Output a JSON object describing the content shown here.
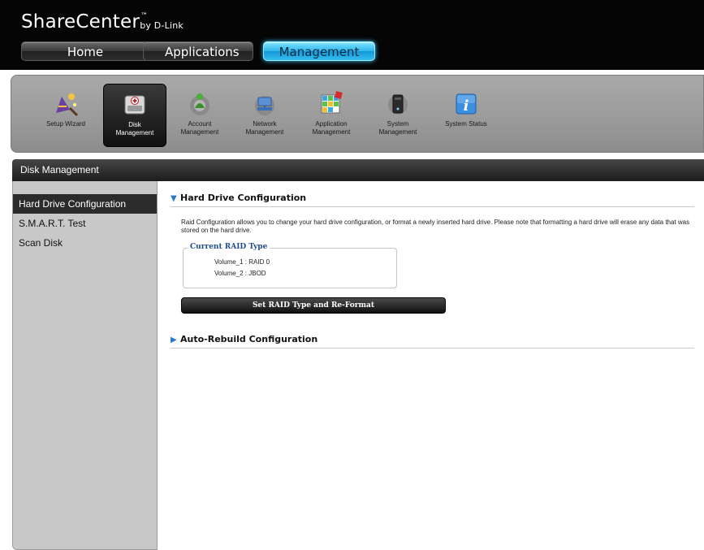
{
  "header": {
    "logo_main": "ShareCenter",
    "logo_tm": "™",
    "logo_by": "by D-Link",
    "tabs": [
      {
        "label": "Home"
      },
      {
        "label": "Applications"
      },
      {
        "label": "Management"
      }
    ]
  },
  "toolbar": {
    "items": [
      {
        "label1": "Setup Wizard",
        "label2": "",
        "icon": "wizard-icon"
      },
      {
        "label1": "Disk",
        "label2": "Management",
        "icon": "disk-icon"
      },
      {
        "label1": "Account",
        "label2": "Management",
        "icon": "account-icon"
      },
      {
        "label1": "Network",
        "label2": "Management",
        "icon": "network-icon"
      },
      {
        "label1": "Application",
        "label2": "Management",
        "icon": "application-icon"
      },
      {
        "label1": "System",
        "label2": "Management",
        "icon": "system-icon"
      },
      {
        "label1": "System Status",
        "label2": "",
        "icon": "info-icon"
      }
    ]
  },
  "section_title": "Disk Management",
  "sidebar": {
    "items": [
      {
        "label": "Hard Drive Configuration"
      },
      {
        "label": "S.M.A.R.T. Test"
      },
      {
        "label": "Scan Disk"
      }
    ]
  },
  "main": {
    "hdc_title": "Hard Drive Configuration",
    "description": "Raid Configuration allows you to change your hard drive configuration, or format a newly inserted hard drive. Please note that formatting a hard drive will erase any data that was stored on the hard drive.",
    "raid_legend": "Current RAID Type",
    "raid_lines": [
      "Volume_1 : RAID 0",
      "Volume_2 : JBOD"
    ],
    "reformat_button": "Set RAID Type and Re-Format",
    "auto_rebuild_title": "Auto-Rebuild Configuration"
  },
  "colors": {
    "accent": "#2fb7ec",
    "header_bg": "#050505",
    "legend_text": "#1f4f8e"
  }
}
